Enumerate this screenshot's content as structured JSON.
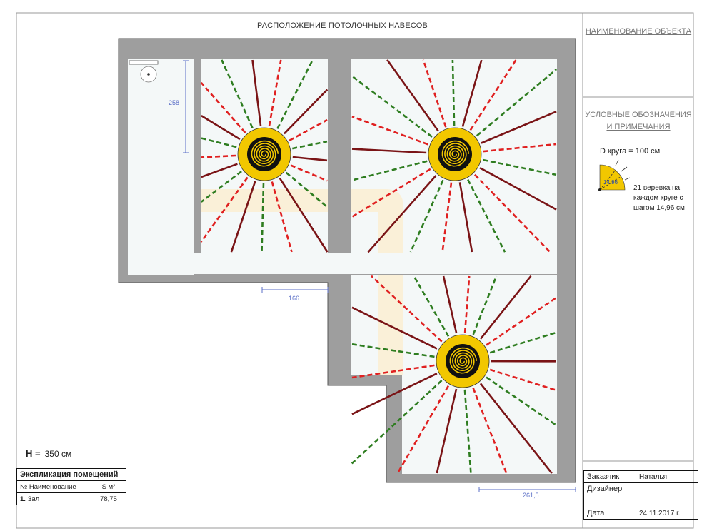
{
  "drawing_title": "РАСПОЛОЖЕНИЕ ПОТОЛОЧНЫХ НАВЕСОВ",
  "right_panel": {
    "object_name": "НАИМЕНОВАНИЕ ОБЪЕКТА",
    "legend_title": "УСЛОВНЫЕ ОБОЗНАЧЕНИЯ И ПРИМЕЧАНИЯ",
    "circle_diameter": "D круга = 100 см",
    "sector_value": "14.96",
    "note": "21 веревка на каждом круге с шагом 14,96 см"
  },
  "dimensions": {
    "d258": "258",
    "d166": "166",
    "d261": "261,5"
  },
  "height": {
    "label": "H =",
    "value": "350 см"
  },
  "explication": {
    "title": "Экспликация помещений",
    "col_name": "№ Наименование",
    "col_area": "S м²",
    "rows": [
      {
        "num": "1.",
        "name": "Зал",
        "area": "78,75"
      }
    ]
  },
  "stamp": {
    "customer_label": "Заказчик",
    "customer_value": "Наталья",
    "designer_label": "Дизайнер",
    "designer_value": "",
    "date_label": "Дата",
    "date_value": "24.11.2017 г."
  },
  "colors": {
    "wall": "#9e9e9e",
    "floor": "#f4f8f8",
    "rope_dark": "#7a1416",
    "rope_red": "#e02020",
    "rope_green": "#2e7d20",
    "ring": "#f2c700",
    "dimension": "#5b6fc7"
  }
}
